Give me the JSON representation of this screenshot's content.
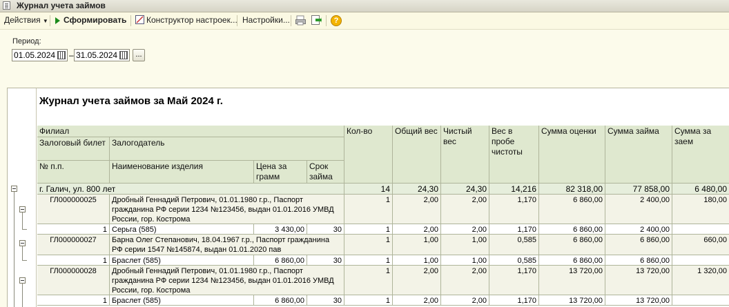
{
  "window": {
    "title": "Журнал учета займов"
  },
  "toolbar": {
    "actions_label": "Действия",
    "generate_label": "Сформировать",
    "constructor_label": "Конструктор настроек...",
    "settings_label": "Настройки..."
  },
  "period": {
    "label": "Период:",
    "from": "01.05.2024",
    "dash": "–",
    "to": "31.05.2024",
    "dots": "..."
  },
  "report": {
    "title": "Журнал учета займов за Май 2024 г.",
    "headers": {
      "branch": "Филиал",
      "ticket": "Залоговый билет",
      "pledger": "Залогодатель",
      "num": "№ п.п.",
      "item": "Наименование изделия",
      "price": "Цена за грамм",
      "term": "Срок займа",
      "qty": "Кол-во",
      "gross": "Общий вес",
      "net": "Чистый вес",
      "fineness": "Вес в пробе чистоты",
      "appraisal": "Сумма оценки",
      "loan": "Сумма займа",
      "fee": "Сумма за заем"
    },
    "group": {
      "name": "г. Галич, ул. 800 лет",
      "qty": "14",
      "gross": "24,30",
      "net": "24,30",
      "fineness": "14,216",
      "appraisal": "82 318,00",
      "loan": "77 858,00",
      "fee": "6 480,00"
    },
    "rows": [
      {
        "ticket": "ГЛ000000025",
        "pledger": "Дробный Геннадий Петрович, 01.01.1980 г.р., Паспорт гражданина РФ серии 1234 №123456, выдан 01.01.2016 УМВД России, гор. Кострома",
        "qty": "1",
        "gross": "2,00",
        "net": "2,00",
        "fineness": "1,170",
        "appraisal": "6 860,00",
        "loan": "2 400,00",
        "fee": "180,00",
        "item": {
          "num": "1",
          "name": "Серьга (585)",
          "price": "3 430,00",
          "term": "30",
          "qty": "1",
          "gross": "2,00",
          "net": "2,00",
          "fineness": "1,170",
          "appraisal": "6 860,00",
          "loan": "2 400,00"
        }
      },
      {
        "ticket": "ГЛ000000027",
        "pledger": "Барна Олег Степанович, 18.04.1967 г.р., Паспорт гражданина РФ серии 1547 №145874, выдан 01.01.2020 пав",
        "qty": "1",
        "gross": "1,00",
        "net": "1,00",
        "fineness": "0,585",
        "appraisal": "6 860,00",
        "loan": "6 860,00",
        "fee": "660,00",
        "item": {
          "num": "1",
          "name": "Браслет (585)",
          "price": "6 860,00",
          "term": "30",
          "qty": "1",
          "gross": "1,00",
          "net": "1,00",
          "fineness": "0,585",
          "appraisal": "6 860,00",
          "loan": "6 860,00"
        }
      },
      {
        "ticket": "ГЛ000000028",
        "pledger": "Дробный Геннадий Петрович, 01.01.1980 г.р., Паспорт гражданина РФ серии 1234 №123456, выдан 01.01.2016 УМВД России, гор. Кострома",
        "qty": "1",
        "gross": "2,00",
        "net": "2,00",
        "fineness": "1,170",
        "appraisal": "13 720,00",
        "loan": "13 720,00",
        "fee": "1 320,00",
        "item": {
          "num": "1",
          "name": "Браслет (585)",
          "price": "6 860,00",
          "term": "30",
          "qty": "1",
          "gross": "2,00",
          "net": "2,00",
          "fineness": "1,170",
          "appraisal": "13 720,00",
          "loan": "13 720,00"
        }
      }
    ]
  },
  "icons": [
    "window-icon",
    "play-icon",
    "constructor-icon",
    "print-icon",
    "export-icon",
    "help-icon",
    "calendar-icon",
    "collapse-icon"
  ]
}
